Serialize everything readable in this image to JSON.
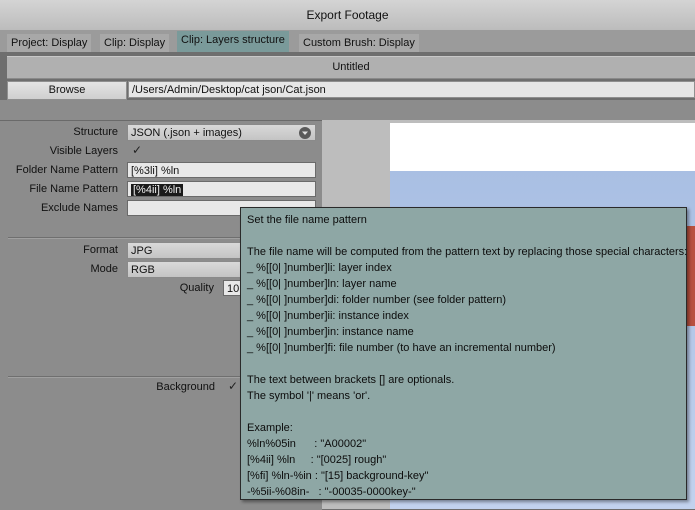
{
  "window": {
    "title": "Export Footage"
  },
  "tabs": [
    {
      "label": "Project: Display",
      "active": false
    },
    {
      "label": "Clip: Display",
      "active": false
    },
    {
      "label": "Clip: Layers structure",
      "active": true
    },
    {
      "label": "Custom Brush: Display",
      "active": false
    }
  ],
  "document": {
    "name": "Untitled"
  },
  "browse": {
    "button_label": "Browse",
    "path": "/Users/Admin/Desktop/cat json/Cat.json"
  },
  "form": {
    "structure": {
      "label": "Structure",
      "value": "JSON (.json + images)"
    },
    "visible_layers": {
      "label": "Visible Layers",
      "checked": true
    },
    "folder_name_pattern": {
      "label": "Folder Name Pattern",
      "value": "[%3li] %ln"
    },
    "file_name_pattern": {
      "label": "File Name Pattern",
      "value": "[%4ii] %ln"
    },
    "exclude_names": {
      "label": "Exclude Names",
      "value": ""
    },
    "format": {
      "label": "Format",
      "value": "JPG"
    },
    "mode": {
      "label": "Mode",
      "value": "RGB"
    },
    "quality": {
      "label": "Quality",
      "value": "10"
    },
    "background": {
      "label": "Background",
      "checked": true
    }
  },
  "tooltip": {
    "lines": [
      "Set the file name pattern",
      "",
      "The file name will be computed from the pattern text by replacing those special characters:",
      "_ %[[0| ]number]li: layer index",
      "_ %[[0| ]number]ln: layer name",
      "_ %[[0| ]number]di: folder number (see folder pattern)",
      "_ %[[0| ]number]ii: instance index",
      "_ %[[0| ]number]in: instance name",
      "_ %[[0| ]number]fi: file number (to have an incremental number)",
      "",
      "The text between brackets [] are optionals.",
      "The symbol '|' means 'or'.",
      "",
      "Example:",
      "%ln%05in      : \"A00002\"",
      "[%4ii] %ln     : \"[0025] rough\"",
      "[%fi] %ln-%in : \"[15] background-key\"",
      "-%5ii-%08in-   : \"-00035-0000key-\""
    ]
  },
  "icons": {
    "check": "✓",
    "dropdown": "chevron-down-icon"
  }
}
